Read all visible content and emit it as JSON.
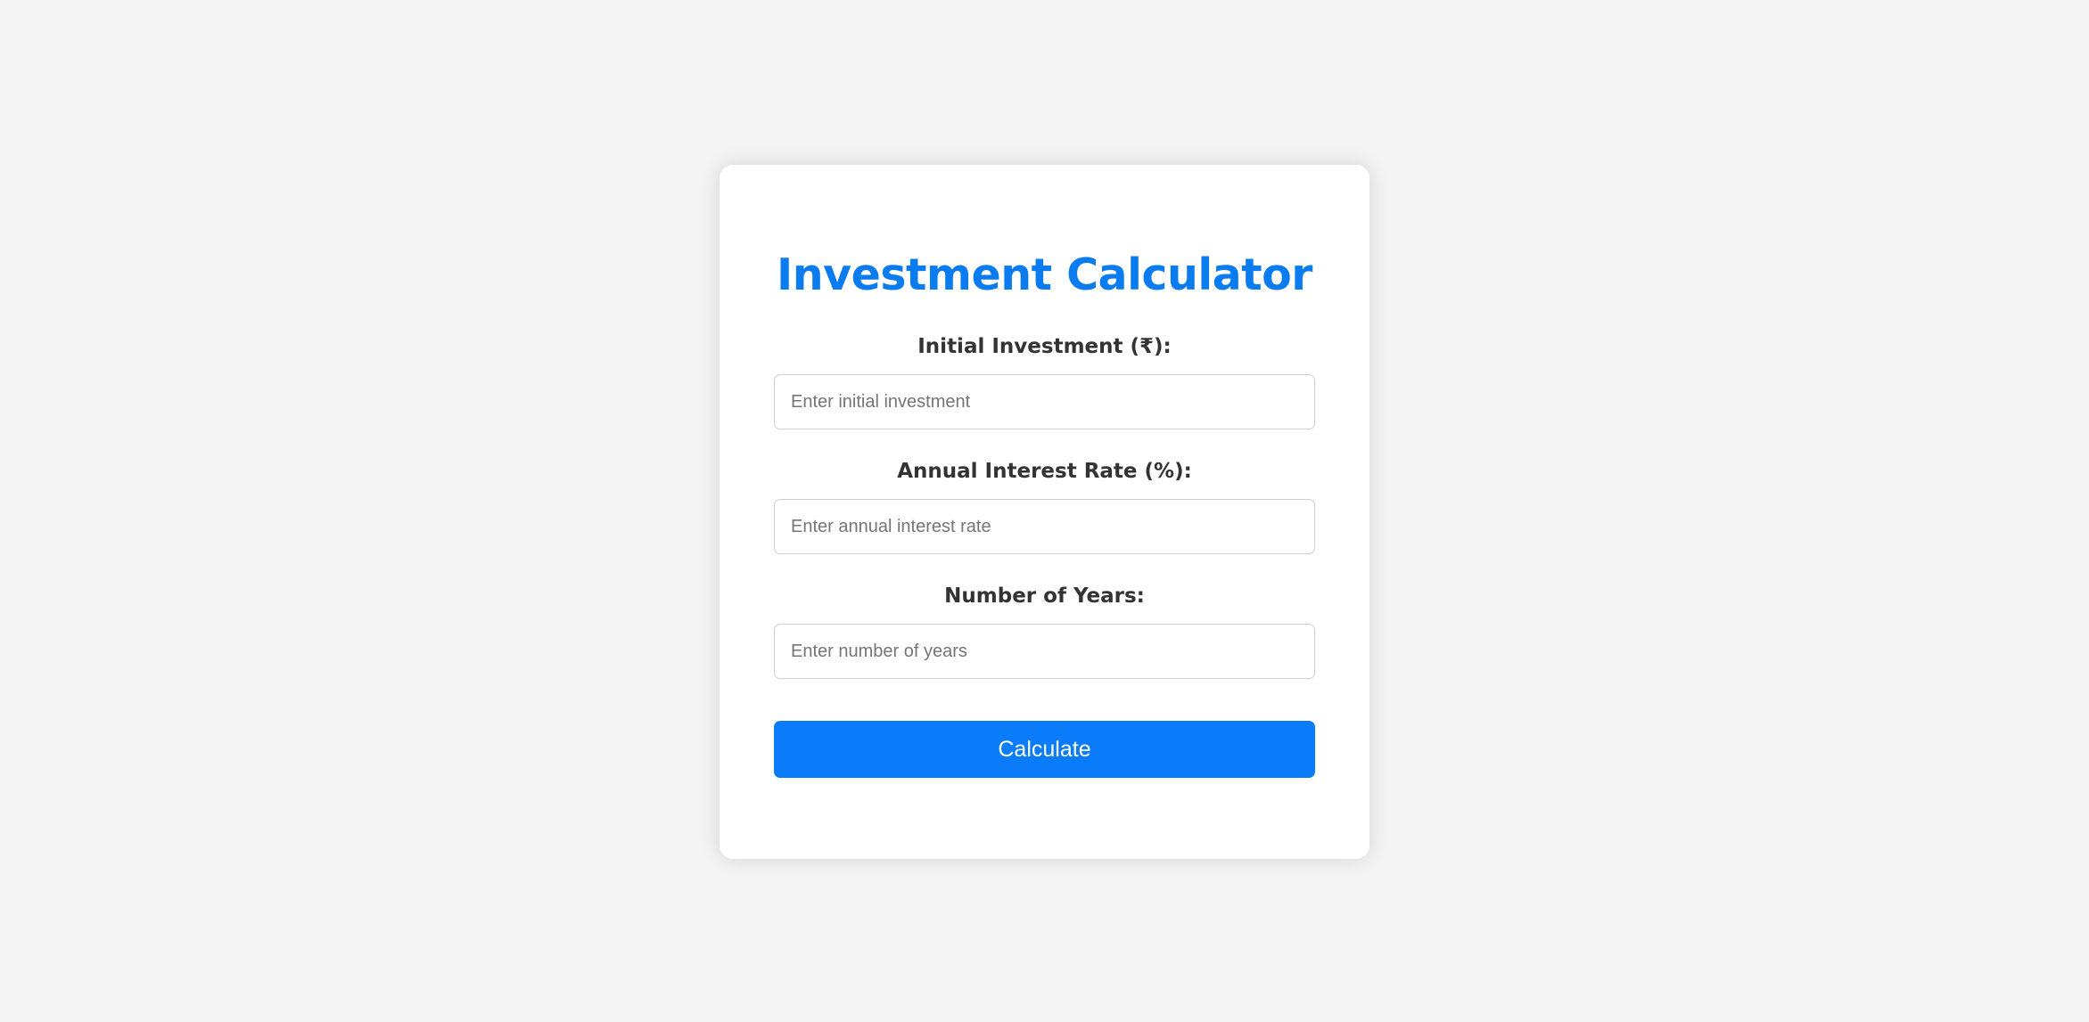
{
  "calculator": {
    "title": "Investment Calculator",
    "fields": [
      {
        "label": "Initial Investment (₹):",
        "placeholder": "Enter initial investment",
        "value": ""
      },
      {
        "label": "Annual Interest Rate (%):",
        "placeholder": "Enter annual interest rate",
        "value": ""
      },
      {
        "label": "Number of Years:",
        "placeholder": "Enter number of years",
        "value": ""
      }
    ],
    "button_label": "Calculate"
  },
  "colors": {
    "accent": "#0a7cf9",
    "title": "#0a7cf0",
    "background": "#f3f3f3",
    "card": "#ffffff",
    "label_text": "#333333"
  }
}
